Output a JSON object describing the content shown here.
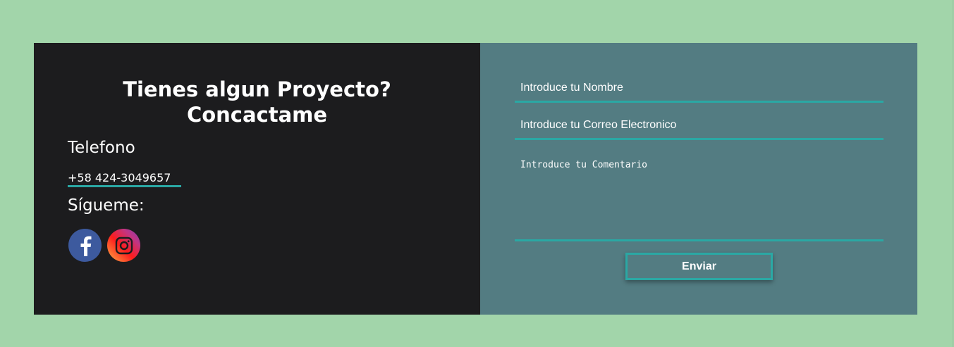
{
  "contact": {
    "headline_line1": "Tienes algun Proyecto?",
    "headline_line2": "Concactame",
    "phone_label": "Telefono",
    "phone_number": "+58 424-3049657",
    "follow_label": "Sígueme:",
    "social": [
      {
        "name": "facebook",
        "icon": "facebook-icon",
        "color": "#3d5a9e"
      },
      {
        "name": "instagram",
        "icon": "instagram-icon",
        "color": "#c13584"
      }
    ]
  },
  "form": {
    "name_placeholder": "Introduce tu Nombre",
    "email_placeholder": "Introduce tu Correo Electronico",
    "comment_placeholder": "Introduce tu Comentario",
    "submit_label": "Enviar"
  },
  "colors": {
    "page_background": "#a2d5aa",
    "left_panel": "#1c1c1e",
    "right_panel": "#537c82",
    "accent": "#2aa8a4"
  }
}
